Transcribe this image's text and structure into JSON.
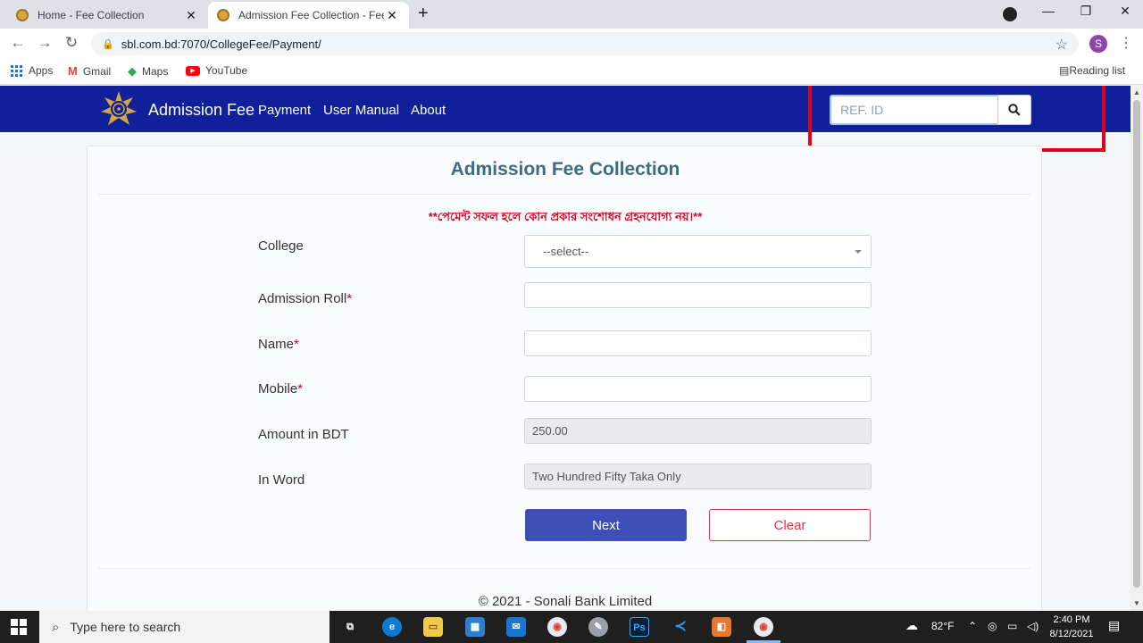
{
  "browser": {
    "tabs": [
      {
        "title": "Home - Fee Collection",
        "active": false
      },
      {
        "title": "Admission Fee Collection - Fee C",
        "active": true
      }
    ],
    "url": "sbl.com.bd:7070/CollegeFee/Payment/",
    "profile_initial": "S",
    "bookmarks": [
      "Apps",
      "Gmail",
      "Maps",
      "YouTube"
    ],
    "reading_list": "Reading list"
  },
  "navbar": {
    "brand": "Admission Fee",
    "links": [
      "Payment",
      "User Manual",
      "About"
    ],
    "search_placeholder": "REF. ID",
    "highlight_color": "#e2001a",
    "bg_color": "#10209a"
  },
  "form": {
    "title": "Admission Fee Collection",
    "notice": "**পেমেন্ট সফল হলে কোন প্রকার সংশোধন গ্রহনযোগ্য নয়।**",
    "fields": {
      "college": {
        "label": "College",
        "value": "--select--"
      },
      "roll": {
        "label": "Admission Roll",
        "required": "*",
        "value": ""
      },
      "name": {
        "label": "Name",
        "required": "*",
        "value": ""
      },
      "mobile": {
        "label": "Mobile",
        "required": "*",
        "value": ""
      },
      "amount": {
        "label": "Amount in BDT",
        "value": "250.00"
      },
      "in_word": {
        "label": "In Word",
        "value": "Two Hundred Fifty Taka  Only"
      }
    },
    "next_label": "Next",
    "clear_label": "Clear",
    "footer": "© 2021 - Sonali Bank Limited"
  },
  "taskbar": {
    "search_placeholder": "Type here to search",
    "weather": "82°F",
    "time": "2:40 PM",
    "date": "8/12/2021"
  }
}
